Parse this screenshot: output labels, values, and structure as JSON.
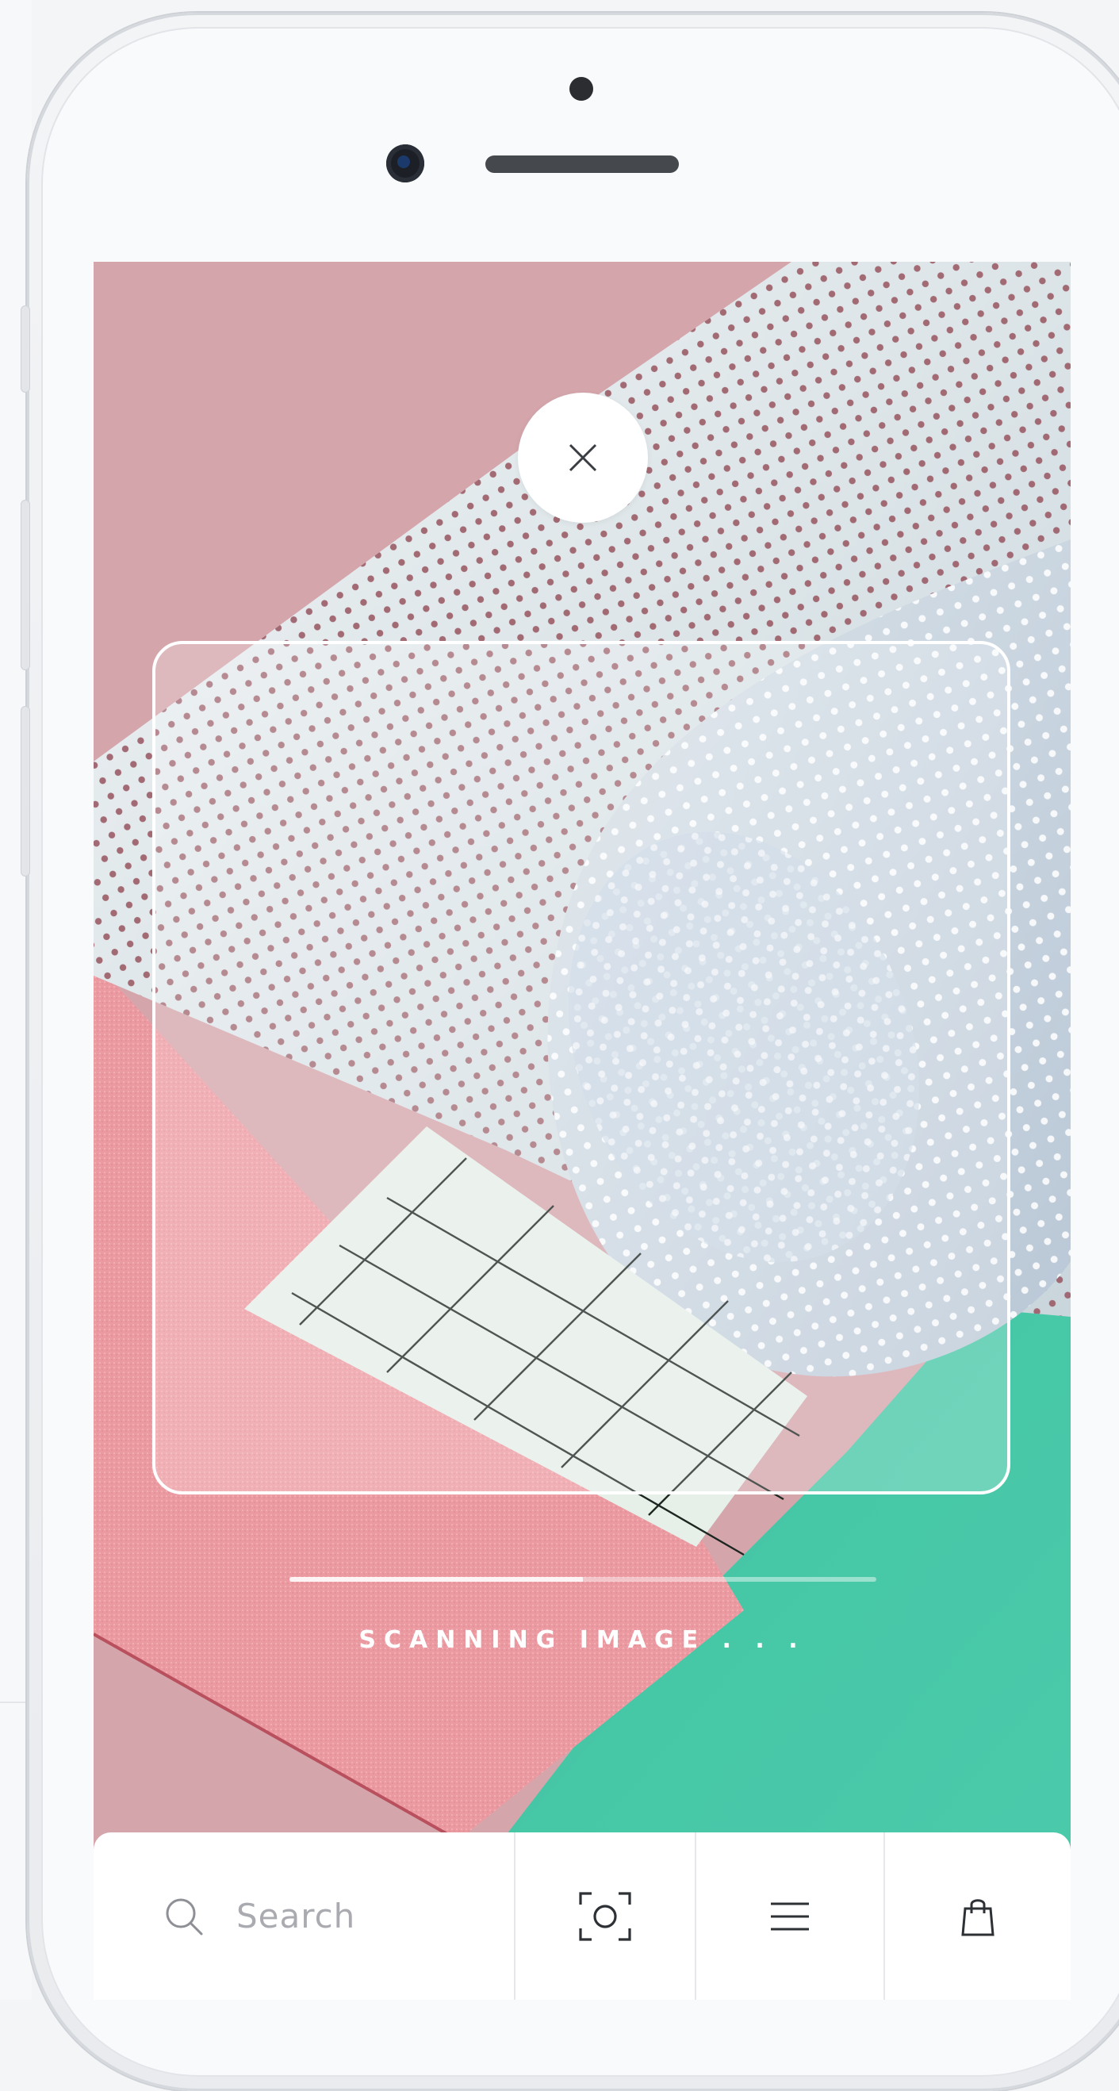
{
  "scanner": {
    "status_text": "SCANNING IMAGE . . .",
    "progress": 0.5
  },
  "toolbar": {
    "search_placeholder": "Search",
    "icons": [
      "search-icon",
      "scan-icon",
      "menu-icon",
      "shopping-bag-icon"
    ]
  },
  "colors": {
    "pink": "#e8a2aa",
    "dusty_pink": "#d3a4aa",
    "mint": "#3fc3a2",
    "frame": "#ffffff",
    "muted_text": "#a9abb0"
  }
}
